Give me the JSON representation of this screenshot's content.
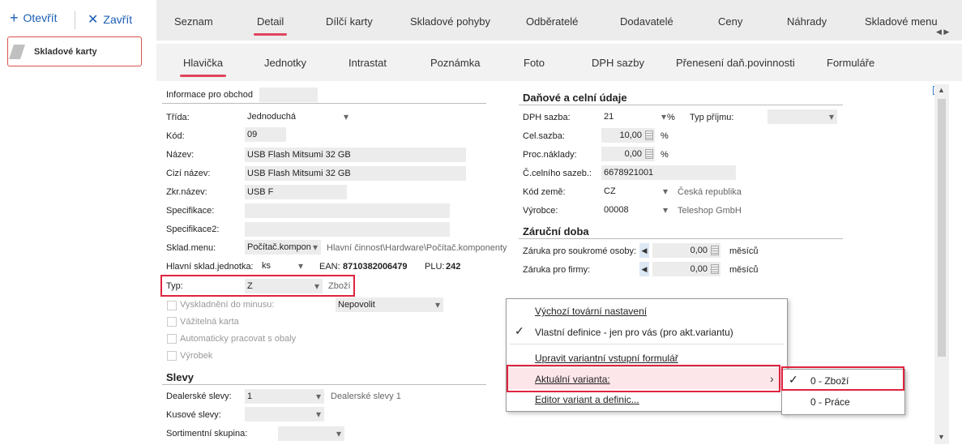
{
  "toolbar": {
    "open_label": "Otevřít",
    "close_label": "Zavřít"
  },
  "nav": {
    "card_label": "Skladové karty"
  },
  "tabs_primary": [
    "Seznam",
    "Detail",
    "Dílčí karty",
    "Skladové pohyby",
    "Odběratelé",
    "Dodavatelé",
    "Ceny",
    "Náhrady",
    "Skladové menu"
  ],
  "tabs_secondary": [
    "Hlavička",
    "Jednotky",
    "Intrastat",
    "Poznámka",
    "Foto",
    "DPH sazby",
    "Přenesení daň.povinnosti",
    "Formuláře"
  ],
  "left": {
    "info_label": "Informace pro obchod",
    "trida_label": "Třída:",
    "trida_value": "Jednoduchá",
    "kod_label": "Kód:",
    "kod_value": "09",
    "nazev_label": "Název:",
    "nazev_value": "USB Flash Mitsumi 32 GB",
    "cizi_label": "Cizí název:",
    "cizi_value": "USB Flash Mitsumi 32 GB",
    "zkr_label": "Zkr.název:",
    "zkr_value": "USB F",
    "spec_label": "Specifikace:",
    "spec2_label": "Specifikace2:",
    "sklmenu_label": "Sklad.menu:",
    "sklmenu_value": "Počítač.kompon",
    "sklmenu_hint": "Hlavní činnost\\Hardware\\Počítač.komponenty",
    "hlj_label": "Hlavní sklad.jednotka:",
    "hlj_value": "ks",
    "ean_label": "EAN:",
    "ean_value": "8710382006479",
    "plu_label": "PLU:",
    "plu_value": "242",
    "typ_label": "Typ:",
    "typ_value": "Z",
    "typ_hint": "Zboží",
    "vysklad_label": "Vyskladnění do minusu:",
    "vysklad_value": "Nepovolit",
    "vazitelna_label": "Vážitelná karta",
    "obaly_label": "Automaticky pracovat s obaly",
    "vyrobek_label": "Výrobek",
    "slevy_title": "Slevy",
    "dealer_label": "Dealerské slevy:",
    "dealer_value": "1",
    "dealer_hint": "Dealerské slevy 1",
    "kusove_label": "Kusové slevy:",
    "sortiment_label": "Sortimentní skupina:"
  },
  "right": {
    "tax_title": "Daňové a celní údaje",
    "dph_label": "DPH sazba:",
    "dph_value": "21",
    "pct": "%",
    "typprijmu_label": "Typ příjmu:",
    "celsazba_label": "Cel.sazba:",
    "celsazba_value": "10,00",
    "procnaklady_label": "Proc.náklady:",
    "procnaklady_value": "0,00",
    "celsazeb_label": "Č.celního sazeb.:",
    "celsazeb_value": "6678921001",
    "zeme_label": "Kód země:",
    "zeme_value": "CZ",
    "zeme_hint": "Česká republika",
    "vyrobce_label": "Výrobce:",
    "vyrobce_value": "00008",
    "vyrobce_hint": "Teleshop GmbH",
    "warranty_title": "Záruční doba",
    "zaruka_os_label": "Záruka pro soukromé osoby:",
    "zaruka_os_value": "0,00",
    "zaruka_fir_label": "Záruka pro firmy:",
    "zaruka_fir_value": "0,00",
    "unit": "měsíců"
  },
  "context_menu": {
    "items": [
      "Výchozí tovární nastavení",
      "Vlastní definice - jen pro vás (pro akt.variantu)",
      "Upravit variantní vstupní formulář",
      "Aktuální varianta:",
      "Editor variant a definic..."
    ],
    "submenu": [
      "0 - Zboží",
      "0 - Práce"
    ]
  }
}
